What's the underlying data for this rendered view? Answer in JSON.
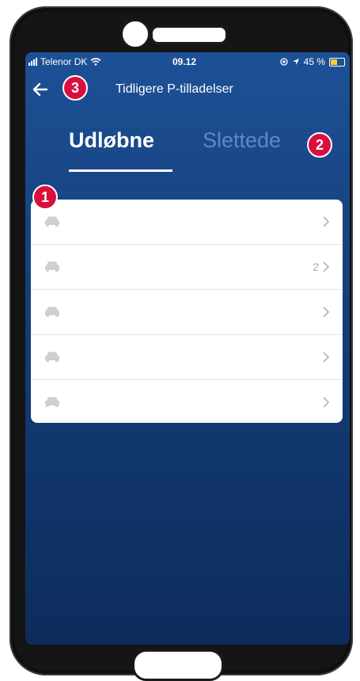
{
  "status_bar": {
    "carrier": "Telenor DK",
    "time": "09.12",
    "battery_percent": "45 %",
    "battery_color": "#f2d02d"
  },
  "nav": {
    "back_icon": "arrow-left-icon",
    "title": "Tidligere P-tilladelser"
  },
  "tabs": [
    {
      "label": "Udløbne",
      "active": true
    },
    {
      "label": "Slettede",
      "active": false
    }
  ],
  "permit_list": {
    "rows": [
      {
        "icon": "car-icon",
        "count": ""
      },
      {
        "icon": "car-icon",
        "count": "2"
      },
      {
        "icon": "car-icon",
        "count": ""
      },
      {
        "icon": "car-icon",
        "count": ""
      },
      {
        "icon": "car-icon",
        "count": ""
      }
    ]
  },
  "callouts": {
    "one": "1",
    "two": "2",
    "three": "3",
    "color": "#d9103e"
  }
}
